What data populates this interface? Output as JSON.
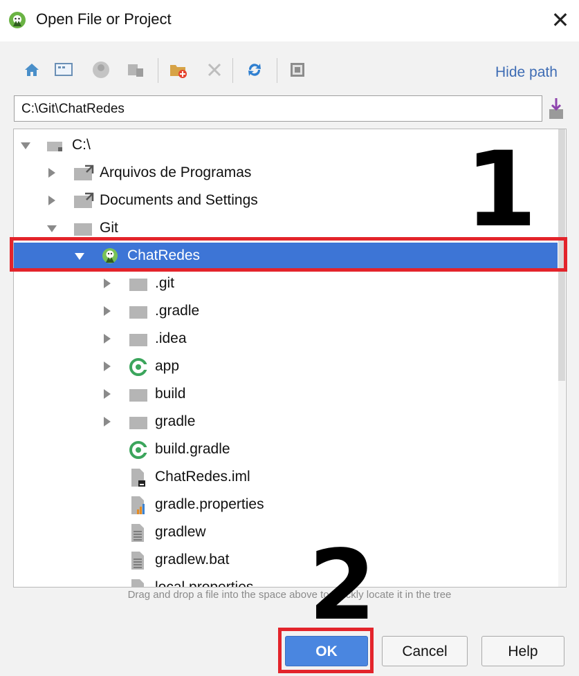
{
  "window": {
    "title": "Open File or Project",
    "close_glyph": "✕"
  },
  "toolbar": {
    "icons": [
      "home-icon",
      "desktop-icon",
      "user-icon",
      "module-icon",
      "new-folder-icon",
      "delete-icon",
      "refresh-icon",
      "show-hidden-icon"
    ],
    "hide_path_label": "Hide path"
  },
  "path": {
    "value": "C:\\Git\\ChatRedes"
  },
  "tree": {
    "rows": [
      {
        "label": "C:\\",
        "icon": "drive-icon",
        "expanded": true
      },
      {
        "label": "Arquivos de Programas",
        "icon": "folder-link-icon",
        "expanded": false
      },
      {
        "label": "Documents and Settings",
        "icon": "folder-link-icon",
        "expanded": false
      },
      {
        "label": "Git",
        "icon": "folder-icon",
        "expanded": true
      },
      {
        "label": "ChatRedes",
        "icon": "android-project-icon",
        "expanded": true,
        "selected": true
      },
      {
        "label": ".git",
        "icon": "folder-icon",
        "expanded": false
      },
      {
        "label": ".gradle",
        "icon": "folder-icon",
        "expanded": false
      },
      {
        "label": ".idea",
        "icon": "folder-icon",
        "expanded": false
      },
      {
        "label": "app",
        "icon": "android-module-icon",
        "expanded": false
      },
      {
        "label": "build",
        "icon": "folder-icon",
        "expanded": false
      },
      {
        "label": "gradle",
        "icon": "folder-icon",
        "expanded": false
      },
      {
        "label": "build.gradle",
        "icon": "gradle-file-icon"
      },
      {
        "label": "ChatRedes.iml",
        "icon": "iml-file-icon"
      },
      {
        "label": "gradle.properties",
        "icon": "properties-file-icon"
      },
      {
        "label": "gradlew",
        "icon": "text-file-icon"
      },
      {
        "label": "gradlew.bat",
        "icon": "text-file-icon"
      },
      {
        "label": "local.properties",
        "icon": "properties-file-icon"
      }
    ]
  },
  "hint": "Drag and drop a file into the space above to quickly locate it in the tree",
  "buttons": {
    "ok": "OK",
    "cancel": "Cancel",
    "help": "Help"
  },
  "annotations": {
    "step1": "1",
    "step2": "2",
    "color": "#e3242b"
  },
  "colors": {
    "selection": "#3d75d6",
    "link": "#3e6cb4",
    "android_green": "#78c257"
  }
}
